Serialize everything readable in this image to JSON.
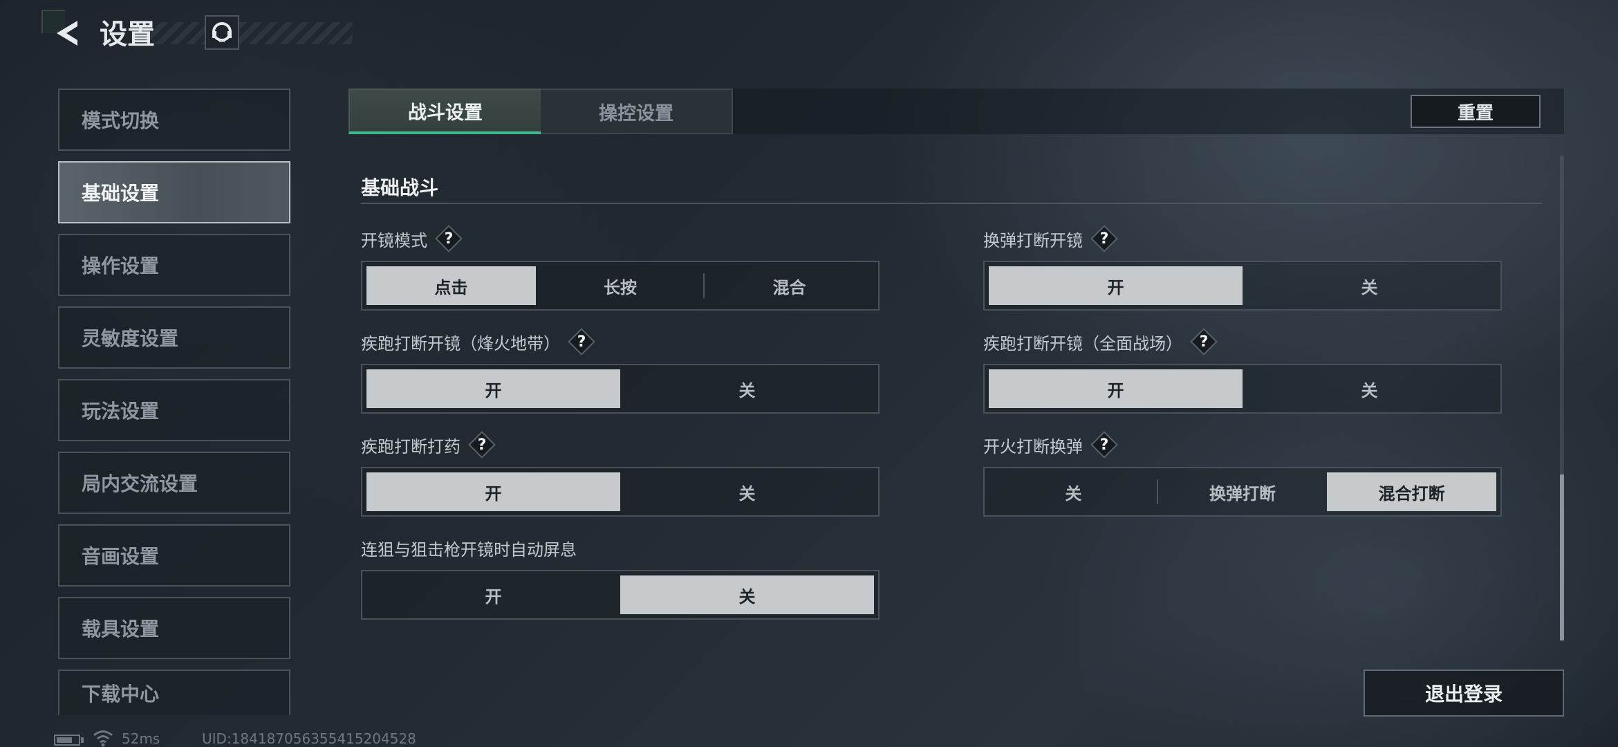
{
  "header": {
    "title": "设置",
    "back_icon": "chevron-left-icon",
    "service_icon": "customer-service-icon"
  },
  "sidebar": {
    "items": [
      {
        "label": "模式切换",
        "active": false
      },
      {
        "label": "基础设置",
        "active": true
      },
      {
        "label": "操作设置",
        "active": false
      },
      {
        "label": "灵敏度设置",
        "active": false
      },
      {
        "label": "玩法设置",
        "active": false
      },
      {
        "label": "局内交流设置",
        "active": false
      },
      {
        "label": "音画设置",
        "active": false
      },
      {
        "label": "载具设置",
        "active": false
      },
      {
        "label": "下载中心",
        "active": false
      }
    ]
  },
  "tabs": [
    {
      "label": "战斗设置",
      "active": true
    },
    {
      "label": "操控设置",
      "active": false
    }
  ],
  "reset_label": "重置",
  "section": {
    "title": "基础战斗",
    "settings": [
      {
        "label": "开镜模式",
        "help": "?",
        "options": [
          "点击",
          "长按",
          "混合"
        ],
        "selected": "点击"
      },
      {
        "label": "换弹打断开镜",
        "help": "?",
        "options": [
          "开",
          "关"
        ],
        "selected": "开"
      },
      {
        "label": "疾跑打断开镜（烽火地带）",
        "help": "?",
        "options": [
          "开",
          "关"
        ],
        "selected": "开"
      },
      {
        "label": "疾跑打断开镜（全面战场）",
        "help": "?",
        "options": [
          "开",
          "关"
        ],
        "selected": "开"
      },
      {
        "label": "疾跑打断打药",
        "help": "?",
        "options": [
          "开",
          "关"
        ],
        "selected": "开"
      },
      {
        "label": "开火打断换弹",
        "help": "?",
        "options": [
          "关",
          "换弹打断",
          "混合打断"
        ],
        "selected": "混合打断"
      },
      {
        "label": "连狙与狙击枪开镜时自动屏息",
        "options": [
          "开",
          "关"
        ],
        "selected": "关"
      }
    ]
  },
  "logout_label": "退出登录",
  "status_bar": {
    "ping": "52ms",
    "uid": "UID:18418705635541520452​8"
  },
  "colors": {
    "accent_green": "#3fb98a",
    "selected_option": "#c7cacd",
    "background": "#1f262d"
  }
}
